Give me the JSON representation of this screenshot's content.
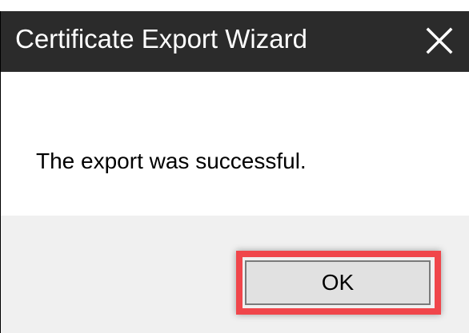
{
  "dialog": {
    "title": "Certificate Export Wizard",
    "close_icon": "close-icon",
    "message": "The export was successful.",
    "ok_label": "OK",
    "highlight_color": "#f0464b",
    "titlebar_color": "#2b2b2b"
  }
}
